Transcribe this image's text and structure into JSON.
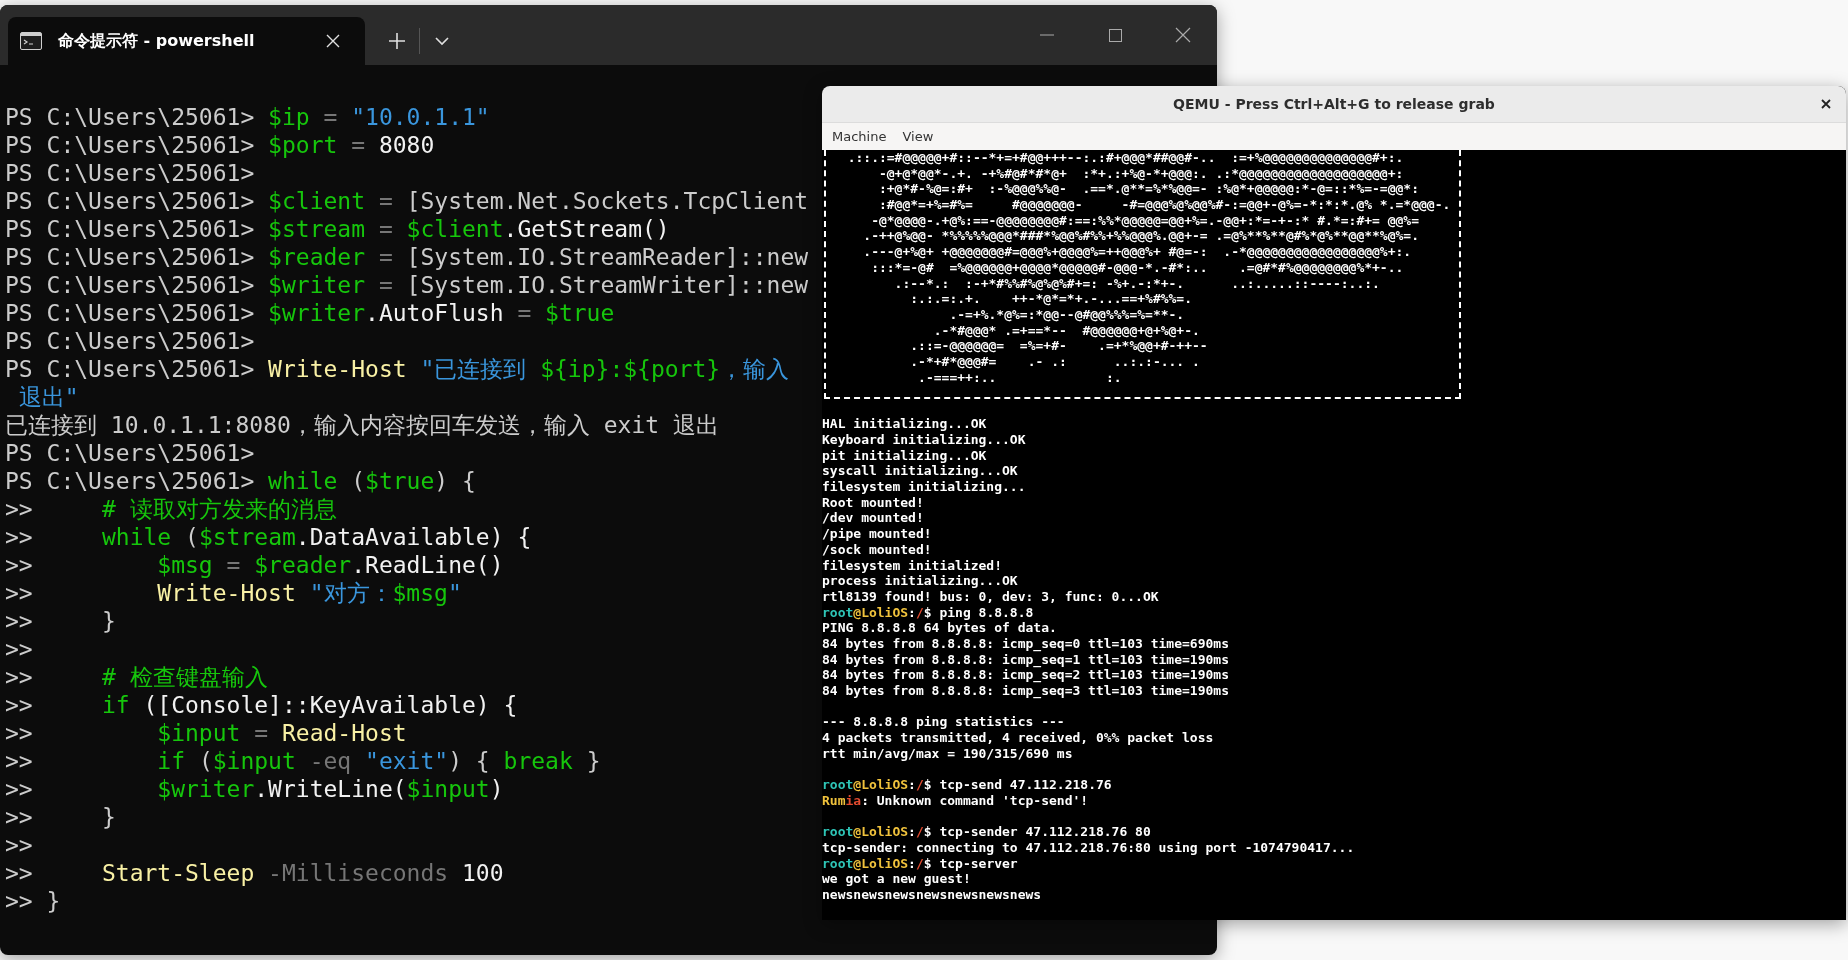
{
  "terminal": {
    "tab": {
      "title": "命令提示符 - powershell",
      "selected": true
    },
    "lines": [
      {
        "segments": [
          {
            "text": "PS C:\\Users\\25061> ",
            "color": "#cccccc"
          },
          {
            "text": "$ip",
            "color": "#16c60c"
          },
          {
            "text": " = ",
            "color": "#767676"
          },
          {
            "text": "\"10.0.1.1\"",
            "color": "#3a96dd"
          }
        ]
      },
      {
        "segments": [
          {
            "text": "PS C:\\Users\\25061> ",
            "color": "#cccccc"
          },
          {
            "text": "$port",
            "color": "#16c60c"
          },
          {
            "text": " = ",
            "color": "#767676"
          },
          {
            "text": "8080",
            "color": "#f2f2f2"
          }
        ]
      },
      {
        "segments": [
          {
            "text": "PS C:\\Users\\25061>",
            "color": "#cccccc"
          }
        ]
      },
      {
        "segments": [
          {
            "text": "PS C:\\Users\\25061> ",
            "color": "#cccccc"
          },
          {
            "text": "$client",
            "color": "#16c60c"
          },
          {
            "text": " = ",
            "color": "#767676"
          },
          {
            "text": "[System.Net.Sockets.TcpClient",
            "color": "#cccccc"
          }
        ]
      },
      {
        "segments": [
          {
            "text": "PS C:\\Users\\25061> ",
            "color": "#cccccc"
          },
          {
            "text": "$stream",
            "color": "#16c60c"
          },
          {
            "text": " = ",
            "color": "#767676"
          },
          {
            "text": "$client",
            "color": "#16c60c"
          },
          {
            "text": ".GetStream()",
            "color": "#f2f2f2"
          }
        ]
      },
      {
        "segments": [
          {
            "text": "PS C:\\Users\\25061> ",
            "color": "#cccccc"
          },
          {
            "text": "$reader",
            "color": "#16c60c"
          },
          {
            "text": " = ",
            "color": "#767676"
          },
          {
            "text": "[System.IO.StreamReader]::new",
            "color": "#cccccc"
          }
        ]
      },
      {
        "segments": [
          {
            "text": "PS C:\\Users\\25061> ",
            "color": "#cccccc"
          },
          {
            "text": "$writer",
            "color": "#16c60c"
          },
          {
            "text": " = ",
            "color": "#767676"
          },
          {
            "text": "[System.IO.StreamWriter]::new",
            "color": "#cccccc"
          }
        ]
      },
      {
        "segments": [
          {
            "text": "PS C:\\Users\\25061> ",
            "color": "#cccccc"
          },
          {
            "text": "$writer",
            "color": "#16c60c"
          },
          {
            "text": ".AutoFlush",
            "color": "#f2f2f2"
          },
          {
            "text": " = ",
            "color": "#767676"
          },
          {
            "text": "$true",
            "color": "#16c60c"
          }
        ]
      },
      {
        "segments": [
          {
            "text": "PS C:\\Users\\25061>",
            "color": "#cccccc"
          }
        ]
      },
      {
        "segments": [
          {
            "text": "PS C:\\Users\\25061> ",
            "color": "#cccccc"
          },
          {
            "text": "Write-Host",
            "color": "#f9f1a5"
          },
          {
            "text": " \"已连接到 ",
            "color": "#3a96dd"
          },
          {
            "text": "${ip}:${port}",
            "color": "#16c60c"
          },
          {
            "text": "，输入",
            "color": "#3a96dd"
          }
        ]
      },
      {
        "segments": [
          {
            "text": " 退出\"",
            "color": "#3a96dd"
          }
        ]
      },
      {
        "segments": [
          {
            "text": "已连接到 10.0.1.1:8080，输入内容按回车发送，输入 exit 退出",
            "color": "#cccccc"
          }
        ]
      },
      {
        "segments": [
          {
            "text": "PS C:\\Users\\25061>",
            "color": "#cccccc"
          }
        ]
      },
      {
        "segments": [
          {
            "text": "PS C:\\Users\\25061> ",
            "color": "#cccccc"
          },
          {
            "text": "while",
            "color": "#16c60c"
          },
          {
            "text": " (",
            "color": "#cccccc"
          },
          {
            "text": "$true",
            "color": "#16c60c"
          },
          {
            "text": ") {",
            "color": "#cccccc"
          }
        ]
      },
      {
        "segments": [
          {
            "text": ">>     ",
            "color": "#cccccc"
          },
          {
            "text": "# 读取对方发来的消息",
            "color": "#16c60c"
          }
        ]
      },
      {
        "segments": [
          {
            "text": ">>     ",
            "color": "#cccccc"
          },
          {
            "text": "while",
            "color": "#16c60c"
          },
          {
            "text": " (",
            "color": "#cccccc"
          },
          {
            "text": "$stream",
            "color": "#16c60c"
          },
          {
            "text": ".DataAvailable) {",
            "color": "#f2f2f2"
          }
        ]
      },
      {
        "segments": [
          {
            "text": ">>         ",
            "color": "#cccccc"
          },
          {
            "text": "$msg",
            "color": "#16c60c"
          },
          {
            "text": " = ",
            "color": "#767676"
          },
          {
            "text": "$reader",
            "color": "#16c60c"
          },
          {
            "text": ".ReadLine()",
            "color": "#f2f2f2"
          }
        ]
      },
      {
        "segments": [
          {
            "text": ">>         ",
            "color": "#cccccc"
          },
          {
            "text": "Write-Host",
            "color": "#f9f1a5"
          },
          {
            "text": " \"对方：",
            "color": "#3a96dd"
          },
          {
            "text": "$msg",
            "color": "#16c60c"
          },
          {
            "text": "\"",
            "color": "#3a96dd"
          }
        ]
      },
      {
        "segments": [
          {
            "text": ">>     }",
            "color": "#cccccc"
          }
        ]
      },
      {
        "segments": [
          {
            "text": ">>",
            "color": "#cccccc"
          }
        ]
      },
      {
        "segments": [
          {
            "text": ">>     ",
            "color": "#cccccc"
          },
          {
            "text": "# 检查键盘输入",
            "color": "#16c60c"
          }
        ]
      },
      {
        "segments": [
          {
            "text": ">>     ",
            "color": "#cccccc"
          },
          {
            "text": "if",
            "color": "#16c60c"
          },
          {
            "text": " ([Console]::KeyAvailable) {",
            "color": "#f2f2f2"
          }
        ]
      },
      {
        "segments": [
          {
            "text": ">>         ",
            "color": "#cccccc"
          },
          {
            "text": "$input",
            "color": "#16c60c"
          },
          {
            "text": " = ",
            "color": "#767676"
          },
          {
            "text": "Read-Host",
            "color": "#f9f1a5"
          }
        ]
      },
      {
        "segments": [
          {
            "text": ">>         ",
            "color": "#cccccc"
          },
          {
            "text": "if",
            "color": "#16c60c"
          },
          {
            "text": " (",
            "color": "#cccccc"
          },
          {
            "text": "$input",
            "color": "#16c60c"
          },
          {
            "text": " -eq ",
            "color": "#767676"
          },
          {
            "text": "\"exit\"",
            "color": "#3a96dd"
          },
          {
            "text": ") { ",
            "color": "#cccccc"
          },
          {
            "text": "break",
            "color": "#16c60c"
          },
          {
            "text": " }",
            "color": "#cccccc"
          }
        ]
      },
      {
        "segments": [
          {
            "text": ">>         ",
            "color": "#cccccc"
          },
          {
            "text": "$writer",
            "color": "#16c60c"
          },
          {
            "text": ".WriteLine(",
            "color": "#f2f2f2"
          },
          {
            "text": "$input",
            "color": "#16c60c"
          },
          {
            "text": ")",
            "color": "#f2f2f2"
          }
        ]
      },
      {
        "segments": [
          {
            "text": ">>     }",
            "color": "#cccccc"
          }
        ]
      },
      {
        "segments": [
          {
            "text": ">>",
            "color": "#cccccc"
          }
        ]
      },
      {
        "segments": [
          {
            "text": ">>     ",
            "color": "#cccccc"
          },
          {
            "text": "Start-Sleep",
            "color": "#f9f1a5"
          },
          {
            "text": " -Milliseconds ",
            "color": "#767676"
          },
          {
            "text": "100",
            "color": "#f2f2f2"
          }
        ]
      },
      {
        "segments": [
          {
            "text": ">> }",
            "color": "#cccccc"
          }
        ]
      }
    ]
  },
  "qemu": {
    "title": "QEMU - Press Ctrl+Alt+G to release grab",
    "menu": [
      "Machine",
      "View"
    ],
    "art": [
      "  .::.:=#@@@@@+#::--*+=+#@@+++--:.:#+@@@*##@@#-..  :=+%@@@@@@@@@@@@@@#+:.",
      "      -@+@*@@*-.+. -+%#@#*#*@+  :*+.:+%@-*+@@@:. .:*@@@@@@@@@@@@@@@@@@@+:",
      "      :+@*#-%@=:#+  :-%@@@%%@-  .==*.@**=%*%@@=- :%@*+@@@@@:*-@=::*%=-=@@*:",
      "      :#@@*=+%=#%=     #@@@@@@@-     -#=@@@%@%@@%#-:=@@+-@%=-*:*:*.@% *.=*@@@-.",
      "     -@*@@@@-.+@%:==-@@@@@@@@#:==:%%*@@@@@=@@+%=.-@@+:*=-+-:* #.*=:#+= @@%=",
      "    .-++@%@@- *%%%%%@@@*###*%@@%#%%+%%@@@%.@@+-= .=@%**%**@#%*@%**@@**%@%=.",
      "    .---@+%@+ +@@@@@@@#=@@@%+@@@@%=++@@@%+ #@=-:  .-*@@@@@@@@@@@@@@@@@%+:.",
      "     :::*=-@#  =%@@@@@@+@@@@*@@@@@#-@@@-*.-#*:..    .=@#*#%@@@@@@@@%*+-..",
      "        .:--*.:  :-+*#%%#%@%@%#+=: -%+.-:*+-.      ..:.....::----:..:.",
      "          :.:.=:.+.    ++-*@*=*+.-...==+%#%%=.",
      "               .-=+%.*@%=:*@@--@#@@%%%=%=**-.",
      "             .-*#@@@* .=+==*--  #@@@@@@+@+%@+-.",
      "          .::=-@@@@@@=  =%=+#-    .=+*%@@+#-++--",
      "          .-*+#*@@@#=    .- .:      ..:.:-... .",
      "           .-===++:..              :."
    ],
    "lines": [
      {
        "kind": "text",
        "segments": [
          {
            "text": "HAL initializing...OK",
            "color": "#ffffff"
          }
        ]
      },
      {
        "kind": "text",
        "segments": [
          {
            "text": "Keyboard initializing...OK",
            "color": "#ffffff"
          }
        ]
      },
      {
        "kind": "text",
        "segments": [
          {
            "text": "pit initializing...OK",
            "color": "#ffffff"
          }
        ]
      },
      {
        "kind": "text",
        "segments": [
          {
            "text": "syscall initializing...OK",
            "color": "#ffffff"
          }
        ]
      },
      {
        "kind": "text",
        "segments": [
          {
            "text": "filesystem initializing...",
            "color": "#ffffff"
          }
        ]
      },
      {
        "kind": "text",
        "segments": [
          {
            "text": "Root mounted!",
            "color": "#ffffff"
          }
        ]
      },
      {
        "kind": "text",
        "segments": [
          {
            "text": "/dev mounted!",
            "color": "#ffffff"
          }
        ]
      },
      {
        "kind": "text",
        "segments": [
          {
            "text": "/pipe mounted!",
            "color": "#ffffff"
          }
        ]
      },
      {
        "kind": "text",
        "segments": [
          {
            "text": "/sock mounted!",
            "color": "#ffffff"
          }
        ]
      },
      {
        "kind": "text",
        "segments": [
          {
            "text": "filesystem initialized!",
            "color": "#ffffff"
          }
        ]
      },
      {
        "kind": "text",
        "segments": [
          {
            "text": "process initializing...OK",
            "color": "#ffffff"
          }
        ]
      },
      {
        "kind": "text",
        "segments": [
          {
            "text": "rtl8139 found! bus: 0, dev: 3, func: 0...OK",
            "color": "#ffffff"
          }
        ]
      },
      {
        "kind": "text",
        "segments": [
          {
            "text": "root",
            "color": "#2ec4b6"
          },
          {
            "text": "@LoliOS",
            "color": "#f0c23c"
          },
          {
            "text": ":",
            "color": "#ffffff"
          },
          {
            "text": "/",
            "color": "#e04a2f"
          },
          {
            "text": "$ ping 8.8.8.8",
            "color": "#ffffff"
          }
        ]
      },
      {
        "kind": "text",
        "segments": [
          {
            "text": "PING 8.8.8.8 64 bytes of data.",
            "color": "#ffffff"
          }
        ]
      },
      {
        "kind": "text",
        "segments": [
          {
            "text": "84 bytes from 8.8.8.8: icmp_seq=0 ttl=103 time=690ms",
            "color": "#ffffff"
          }
        ]
      },
      {
        "kind": "text",
        "segments": [
          {
            "text": "84 bytes from 8.8.8.8: icmp_seq=1 ttl=103 time=190ms",
            "color": "#ffffff"
          }
        ]
      },
      {
        "kind": "text",
        "segments": [
          {
            "text": "84 bytes from 8.8.8.8: icmp_seq=2 ttl=103 time=190ms",
            "color": "#ffffff"
          }
        ]
      },
      {
        "kind": "text",
        "segments": [
          {
            "text": "84 bytes from 8.8.8.8: icmp_seq=3 ttl=103 time=190ms",
            "color": "#ffffff"
          }
        ]
      },
      {
        "kind": "blank"
      },
      {
        "kind": "text",
        "segments": [
          {
            "text": "--- 8.8.8.8 ping statistics ---",
            "color": "#ffffff"
          }
        ]
      },
      {
        "kind": "text",
        "segments": [
          {
            "text": "4 packets transmitted, 4 received, 0%% packet loss",
            "color": "#ffffff"
          }
        ]
      },
      {
        "kind": "text",
        "segments": [
          {
            "text": "rtt min/avg/max = 190/315/690 ms",
            "color": "#ffffff"
          }
        ]
      },
      {
        "kind": "blank"
      },
      {
        "kind": "text",
        "segments": [
          {
            "text": "root",
            "color": "#2ec4b6"
          },
          {
            "text": "@LoliOS",
            "color": "#f0c23c"
          },
          {
            "text": ":",
            "color": "#ffffff"
          },
          {
            "text": "/",
            "color": "#e04a2f"
          },
          {
            "text": "$ tcp-send 47.112.218.76",
            "color": "#ffffff"
          }
        ]
      },
      {
        "kind": "text",
        "segments": [
          {
            "text": "Rum",
            "color": "#f0c23c"
          },
          {
            "text": "ia",
            "color": "#e04a2f"
          },
          {
            "text": ": Unknown command 'tcp-send'!",
            "color": "#ffffff"
          }
        ]
      },
      {
        "kind": "blank"
      },
      {
        "kind": "text",
        "segments": [
          {
            "text": "root",
            "color": "#2ec4b6"
          },
          {
            "text": "@LoliOS",
            "color": "#f0c23c"
          },
          {
            "text": ":",
            "color": "#ffffff"
          },
          {
            "text": "/",
            "color": "#e04a2f"
          },
          {
            "text": "$ tcp-sender 47.112.218.76 80",
            "color": "#ffffff"
          }
        ]
      },
      {
        "kind": "text",
        "segments": [
          {
            "text": "tcp-sender: connecting to 47.112.218.76:80 using port -1074790417...",
            "color": "#ffffff"
          }
        ]
      },
      {
        "kind": "text",
        "segments": [
          {
            "text": "root",
            "color": "#2ec4b6"
          },
          {
            "text": "@LoliOS",
            "color": "#f0c23c"
          },
          {
            "text": ":",
            "color": "#ffffff"
          },
          {
            "text": "/",
            "color": "#e04a2f"
          },
          {
            "text": "$ tcp-server",
            "color": "#ffffff"
          }
        ]
      },
      {
        "kind": "text",
        "segments": [
          {
            "text": "we got a new guest!",
            "color": "#ffffff"
          }
        ]
      },
      {
        "kind": "text",
        "segments": [
          {
            "text": "newsnewsnewsnewsnewsnewsnews",
            "color": "#ffffff"
          }
        ]
      }
    ]
  }
}
